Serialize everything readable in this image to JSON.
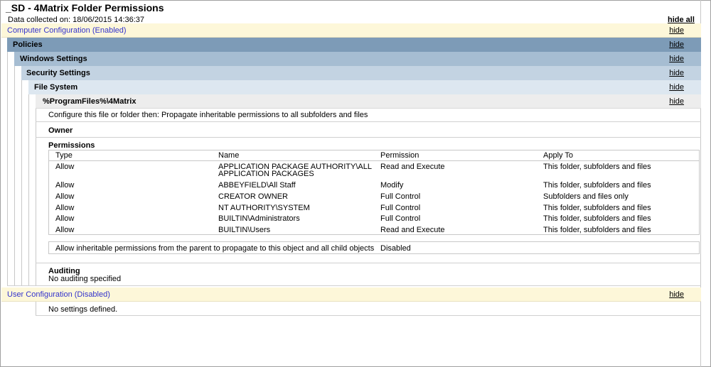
{
  "header": {
    "title": "_SD - 4Matrix Folder Permissions",
    "collected": "Data collected on: 18/06/2015 14:36:37",
    "hide_all": "hide all"
  },
  "hide_label": "hide",
  "computer_config": {
    "label": "Computer Configuration (Enabled)"
  },
  "policies": {
    "label": "Policies"
  },
  "windows_settings": {
    "label": "Windows Settings"
  },
  "security_settings": {
    "label": "Security Settings"
  },
  "file_system": {
    "label": "File System"
  },
  "path": {
    "label": "%ProgramFiles%\\4Matrix"
  },
  "configure_text": "Configure this file or folder then: Propagate inheritable permissions to all subfolders and files",
  "owner": {
    "heading": "Owner"
  },
  "permissions": {
    "heading": "Permissions",
    "columns": [
      "Type",
      "Name",
      "Permission",
      "Apply To"
    ],
    "rows": [
      {
        "type": "Allow",
        "name": "APPLICATION PACKAGE AUTHORITY\\ALL",
        "name2": "APPLICATION PACKAGES",
        "permission": "Read and Execute",
        "apply_to": "This folder, subfolders and files"
      },
      {
        "type": "Allow",
        "name": "ABBEYFIELD\\All Staff",
        "permission": "Modify",
        "apply_to": "This folder, subfolders and files"
      },
      {
        "type": "Allow",
        "name": "CREATOR OWNER",
        "permission": "Full Control",
        "apply_to": "Subfolders and files only"
      },
      {
        "type": "Allow",
        "name": "NT AUTHORITY\\SYSTEM",
        "permission": "Full Control",
        "apply_to": "This folder, subfolders and files"
      },
      {
        "type": "Allow",
        "name": "BUILTIN\\Administrators",
        "permission": "Full Control",
        "apply_to": "This folder, subfolders and files"
      },
      {
        "type": "Allow",
        "name": "BUILTIN\\Users",
        "permission": "Read and Execute",
        "apply_to": "This folder, subfolders and files"
      }
    ],
    "inheritance_label": "Allow inheritable permissions from the parent to propagate to this object and all child objects",
    "inheritance_value": "Disabled"
  },
  "auditing": {
    "heading": "Auditing",
    "value": "No auditing specified"
  },
  "user_config": {
    "label": "User Configuration (Disabled)",
    "value": "No settings defined."
  }
}
